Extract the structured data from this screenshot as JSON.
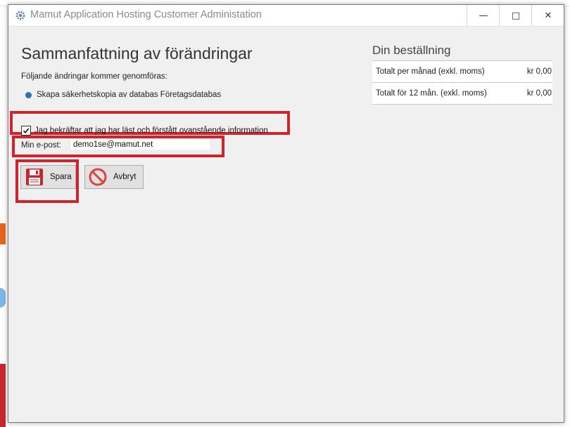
{
  "window": {
    "title": "Mamut Application Hosting Customer Administation",
    "controls": {
      "minimize": "—",
      "maximize": "□",
      "close": "✕"
    }
  },
  "summary": {
    "heading": "Sammanfattning av förändringar",
    "intro": "Följande ändringar kommer genomföras:",
    "changes": [
      "Skapa säkerhetskopia av databas Företagsdatabas"
    ]
  },
  "order": {
    "title": "Din beställning",
    "rows": [
      {
        "label": "Totalt per månad (exkl. moms)",
        "value": "kr 0,00"
      },
      {
        "label": "Totalt för 12 mån. (exkl. moms)",
        "value": "kr 0,00"
      }
    ]
  },
  "confirm": {
    "label": "Jag bekräftar att jag har läst och förstått ovanstående information",
    "checked": true
  },
  "email": {
    "label": "Min e-post:",
    "value": "demo1se@mamut.net"
  },
  "buttons": {
    "save": "Spara",
    "cancel": "Avbryt"
  },
  "colors": {
    "highlight": "#d0232b",
    "bullet": "#2f6fb5",
    "save_icon": "#c8262e",
    "cancel_icon": "#d9443c"
  },
  "icons": {
    "app": "gear-icon",
    "save": "floppy-disk-icon",
    "cancel": "no-entry-icon"
  }
}
